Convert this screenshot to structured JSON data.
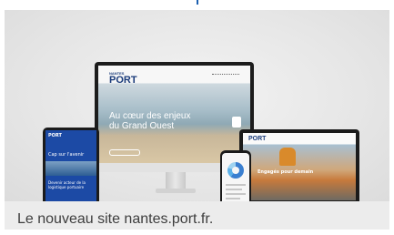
{
  "caption": "Le nouveau site nantes.port.fr.",
  "desktop": {
    "logo_top": "NANTES",
    "logo_main": "PORT",
    "hero_text": "Au cœur des enjeux du Grand Ouest"
  },
  "tablet": {
    "logo": "PORT",
    "headline": "Cap sur l'avenir",
    "body": "Devenir acteur de la logistique portuaire"
  },
  "laptop": {
    "logo": "PORT",
    "title": "Engagés pour demain"
  },
  "colors": {
    "brand_blue": "#1a3b7a",
    "tablet_blue": "#1c4aa5",
    "accent_orange": "#d98a2b"
  }
}
